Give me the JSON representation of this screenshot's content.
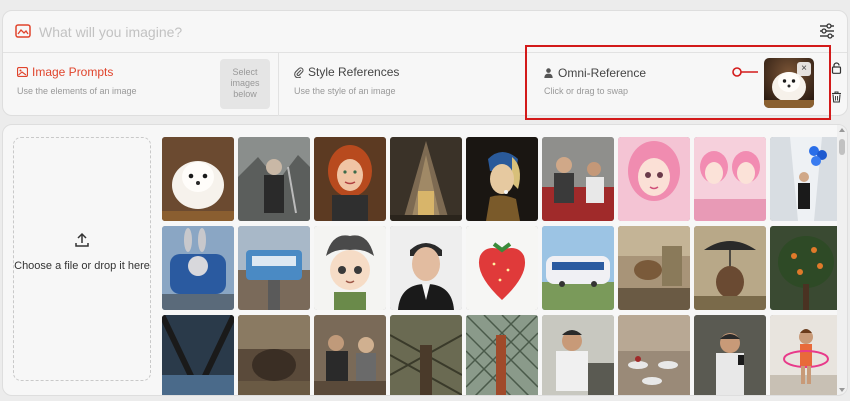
{
  "prompt": {
    "placeholder": "What will you imagine?",
    "icons": {
      "image": "image-icon",
      "settings": "sliders-icon"
    }
  },
  "references": {
    "image_prompts": {
      "title": "Image Prompts",
      "subtitle": "Use the elements of an image",
      "select_label": "Select images below",
      "icon": "image-icon"
    },
    "style_references": {
      "title": "Style References",
      "subtitle": "Use the style of an image",
      "icon": "paperclip-icon"
    },
    "omni_reference": {
      "title": "Omni-Reference",
      "subtitle": "Click or drag to swap",
      "icon": "person-icon",
      "thumbnail": "fluffy white pomeranian puppy",
      "close_label": "×"
    }
  },
  "side_icons": [
    "lock-icon",
    "trash-icon"
  ],
  "upload": {
    "label": "Choose a file or drop it here",
    "icon": "upload-icon"
  },
  "gallery": {
    "images": [
      "white fluffy puppy",
      "man with sword in wasteland",
      "red-haired woman portrait",
      "ornate gothic cathedral",
      "girl with pearl earring painting",
      "man in red room",
      "pink-haired doll girl",
      "pink-haired dolls",
      "man with blue balloons in hallway",
      "cartoon rabbit train",
      "elevated train in city",
      "anime boy sketch",
      "man in suit portrait",
      "watercolor strawberry",
      "anime train",
      "blurred street scene",
      "person with umbrella",
      "orange tree",
      "bridge cables",
      "blurred rooftop",
      "blurred cafe",
      "fence and tower",
      "bridge through fence",
      "man on sofa",
      "cafe tables",
      "man with smartphone",
      "girl with hula hoop"
    ]
  },
  "colors": {
    "accent": "#e0442c",
    "highlight": "#d31a1a"
  }
}
